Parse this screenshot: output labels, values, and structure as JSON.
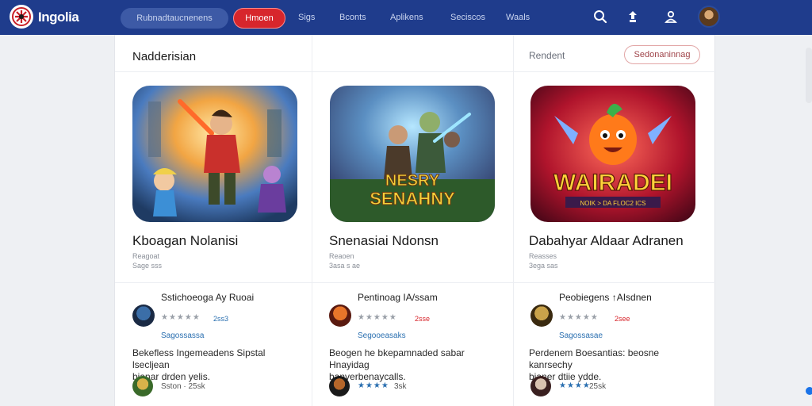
{
  "app": {
    "brand": "Ingolia"
  },
  "header": {
    "search_placeholder": "Rubnadtaucnenens",
    "primary_button": "Hmoen",
    "nav": [
      "Sigs",
      "Bconts",
      "Aplikens",
      "Seciscos",
      "Waals"
    ]
  },
  "main": {
    "section_title": "Nadderisian",
    "recent_label": "Rendent",
    "sort_button": "Sedonaninnag"
  },
  "games": [
    {
      "title": "Kboagan Nolanisi",
      "meta1": "Reagoat",
      "meta2": "Sage sss"
    },
    {
      "title": "Snenasiai Ndonsn",
      "meta1": "Reaoen",
      "meta2": "3asa s ae"
    },
    {
      "title": "Dabahyar Aldaar Adranen",
      "meta1": "Reasses",
      "meta2": "3ega sas"
    }
  ],
  "art_text": {
    "game2_line1": "NESRY",
    "game2_line2": "SENAHNY",
    "game3_title": "WAIRADEI",
    "game3_sub": "NOIK > DA FLOC2 ICS"
  },
  "reviews": [
    {
      "name": "Sstichoeoga Ay Ruoai",
      "rating": "2ss3",
      "tag": "Sagossassa",
      "text_l1": "Bekefless Ingemeadens Sipstal lsecljean",
      "text_l2": "bianar drden yelis.",
      "footer": "Sston · 25sk"
    },
    {
      "name": "Pentinoag IA/ssam",
      "rating": "2sse",
      "tag": "Segooeasaks",
      "text_l1": "Beogen he bkepamnaded sabar Hnayidag",
      "text_l2": "banverbenaycalls.",
      "footer": "3sk"
    },
    {
      "name": "Peobiegens ↑AIsdnen",
      "rating": "2see",
      "tag": "Sagossasae",
      "text_l1": "Perdenem Boesantias: beosne kanrsechy",
      "text_l2": "bianer dtiie ydde.",
      "footer": "25sk"
    }
  ],
  "colors": {
    "topbar": "#1f3c8c",
    "accent_red": "#d7262c",
    "star_gray": "#9aa0a8",
    "star_blue": "#2a6fb0"
  },
  "icons": [
    "logo-icon",
    "search-icon",
    "notification-icon",
    "profile-icon",
    "avatar"
  ]
}
